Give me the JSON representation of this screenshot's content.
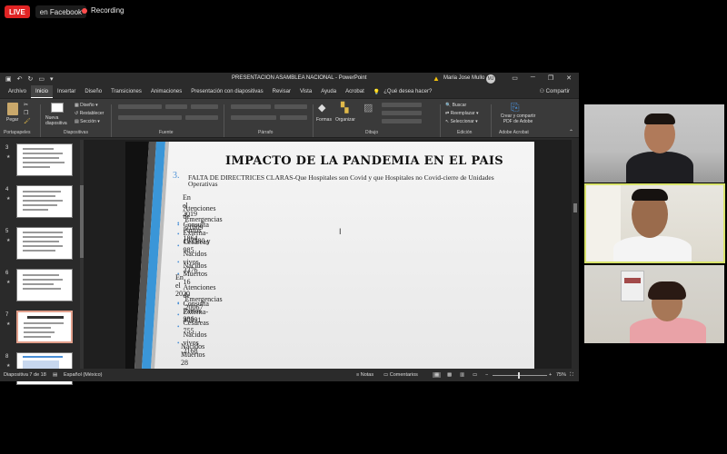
{
  "live": {
    "badge": "LIVE",
    "platform": "en Facebook",
    "recording": "Recording"
  },
  "app": {
    "title": "PRESENTACION ASAMBLEA NACIONAL - PowerPoint",
    "user_name": "Maria Jose Mullo",
    "user_initials": "MJ"
  },
  "menu": {
    "items": [
      "Archivo",
      "Inicio",
      "Insertar",
      "Diseño",
      "Transiciones",
      "Animaciones",
      "Presentación con diapositivas",
      "Revisar",
      "Vista",
      "Ayuda",
      "Acrobat",
      "¿Qué desea hacer?"
    ],
    "active_index": 1,
    "share": "Compartir"
  },
  "ribbon": {
    "paste": "Pegar",
    "new_slide": "Nueva diapositiva",
    "layout": "Diseño",
    "reset": "Restablecer",
    "section": "Sección",
    "shapes": "Formas",
    "arrange": "Organizar",
    "find": "Buscar",
    "replace": "Reemplazar",
    "select": "Seleccionar",
    "create_pdf": "Crear y compartir PDF de Adobe",
    "groups": [
      "Portapapeles",
      "Diapositivas",
      "Fuente",
      "Párrafo",
      "Dibujo",
      "Edición",
      "Adobe Acrobat"
    ]
  },
  "thumbnails": [
    {
      "num": "3",
      "star": "★"
    },
    {
      "num": "4",
      "star": "★"
    },
    {
      "num": "5",
      "star": "★"
    },
    {
      "num": "6",
      "star": "★"
    },
    {
      "num": "7",
      "star": "★"
    },
    {
      "num": "8",
      "star": "★"
    }
  ],
  "slide": {
    "title": "IMPACTO DE LA PANDEMIA EN EL PAIS",
    "point_number": "3.",
    "point_text": "FALTA DE DIRECTRICES CLARAS-Que Hospitales son Covid y que Hospitales no Covid-cierre de Unidades Operativas",
    "year1": "En el 2019",
    "items1": [
      "Atenciones de Consulta Externa-103580 y",
      "Emergencias 51009",
      "Partos 1864",
      "Cesáreas 985",
      "Nacidos vivos 3376",
      "Nacidos Muertos 16"
    ],
    "year2": "En el 2020",
    "items2": [
      "Atenciones de Consulta Externa-40391",
      "Emergencias 20067",
      "Partos 986",
      "Cesáreas 755",
      "Nacidos vivos 2168",
      "Nacidos Muertos 28"
    ]
  },
  "status": {
    "slide_counter": "Diapositiva 7 de 18",
    "language": "Español (México)",
    "notes": "Notas",
    "comments": "Comentarios",
    "zoom": "75%"
  },
  "colors": {
    "live": "#e02424",
    "accent_blue": "#4a8fd6",
    "speaking_border": "#d8e36b"
  }
}
